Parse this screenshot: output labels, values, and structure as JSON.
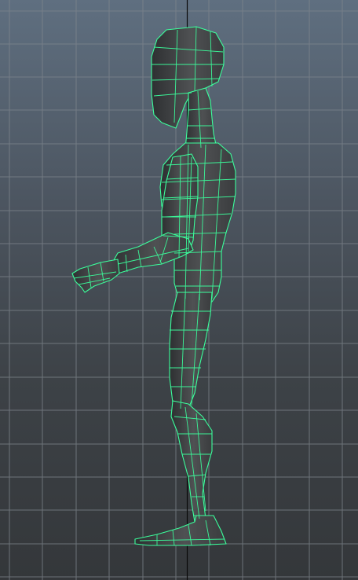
{
  "viewport": {
    "view": "side",
    "background_top": "#5f6f80",
    "background_bottom": "#34373a",
    "grid_color": "#7f868d",
    "axis_color": "#0a0a0a"
  },
  "model": {
    "name_icon": "humanoid-wireframe-mesh",
    "wire_color": "#3bff9c",
    "shade_color": "#4a4c4e",
    "shade_dark": "#2e3032",
    "selected": true
  }
}
